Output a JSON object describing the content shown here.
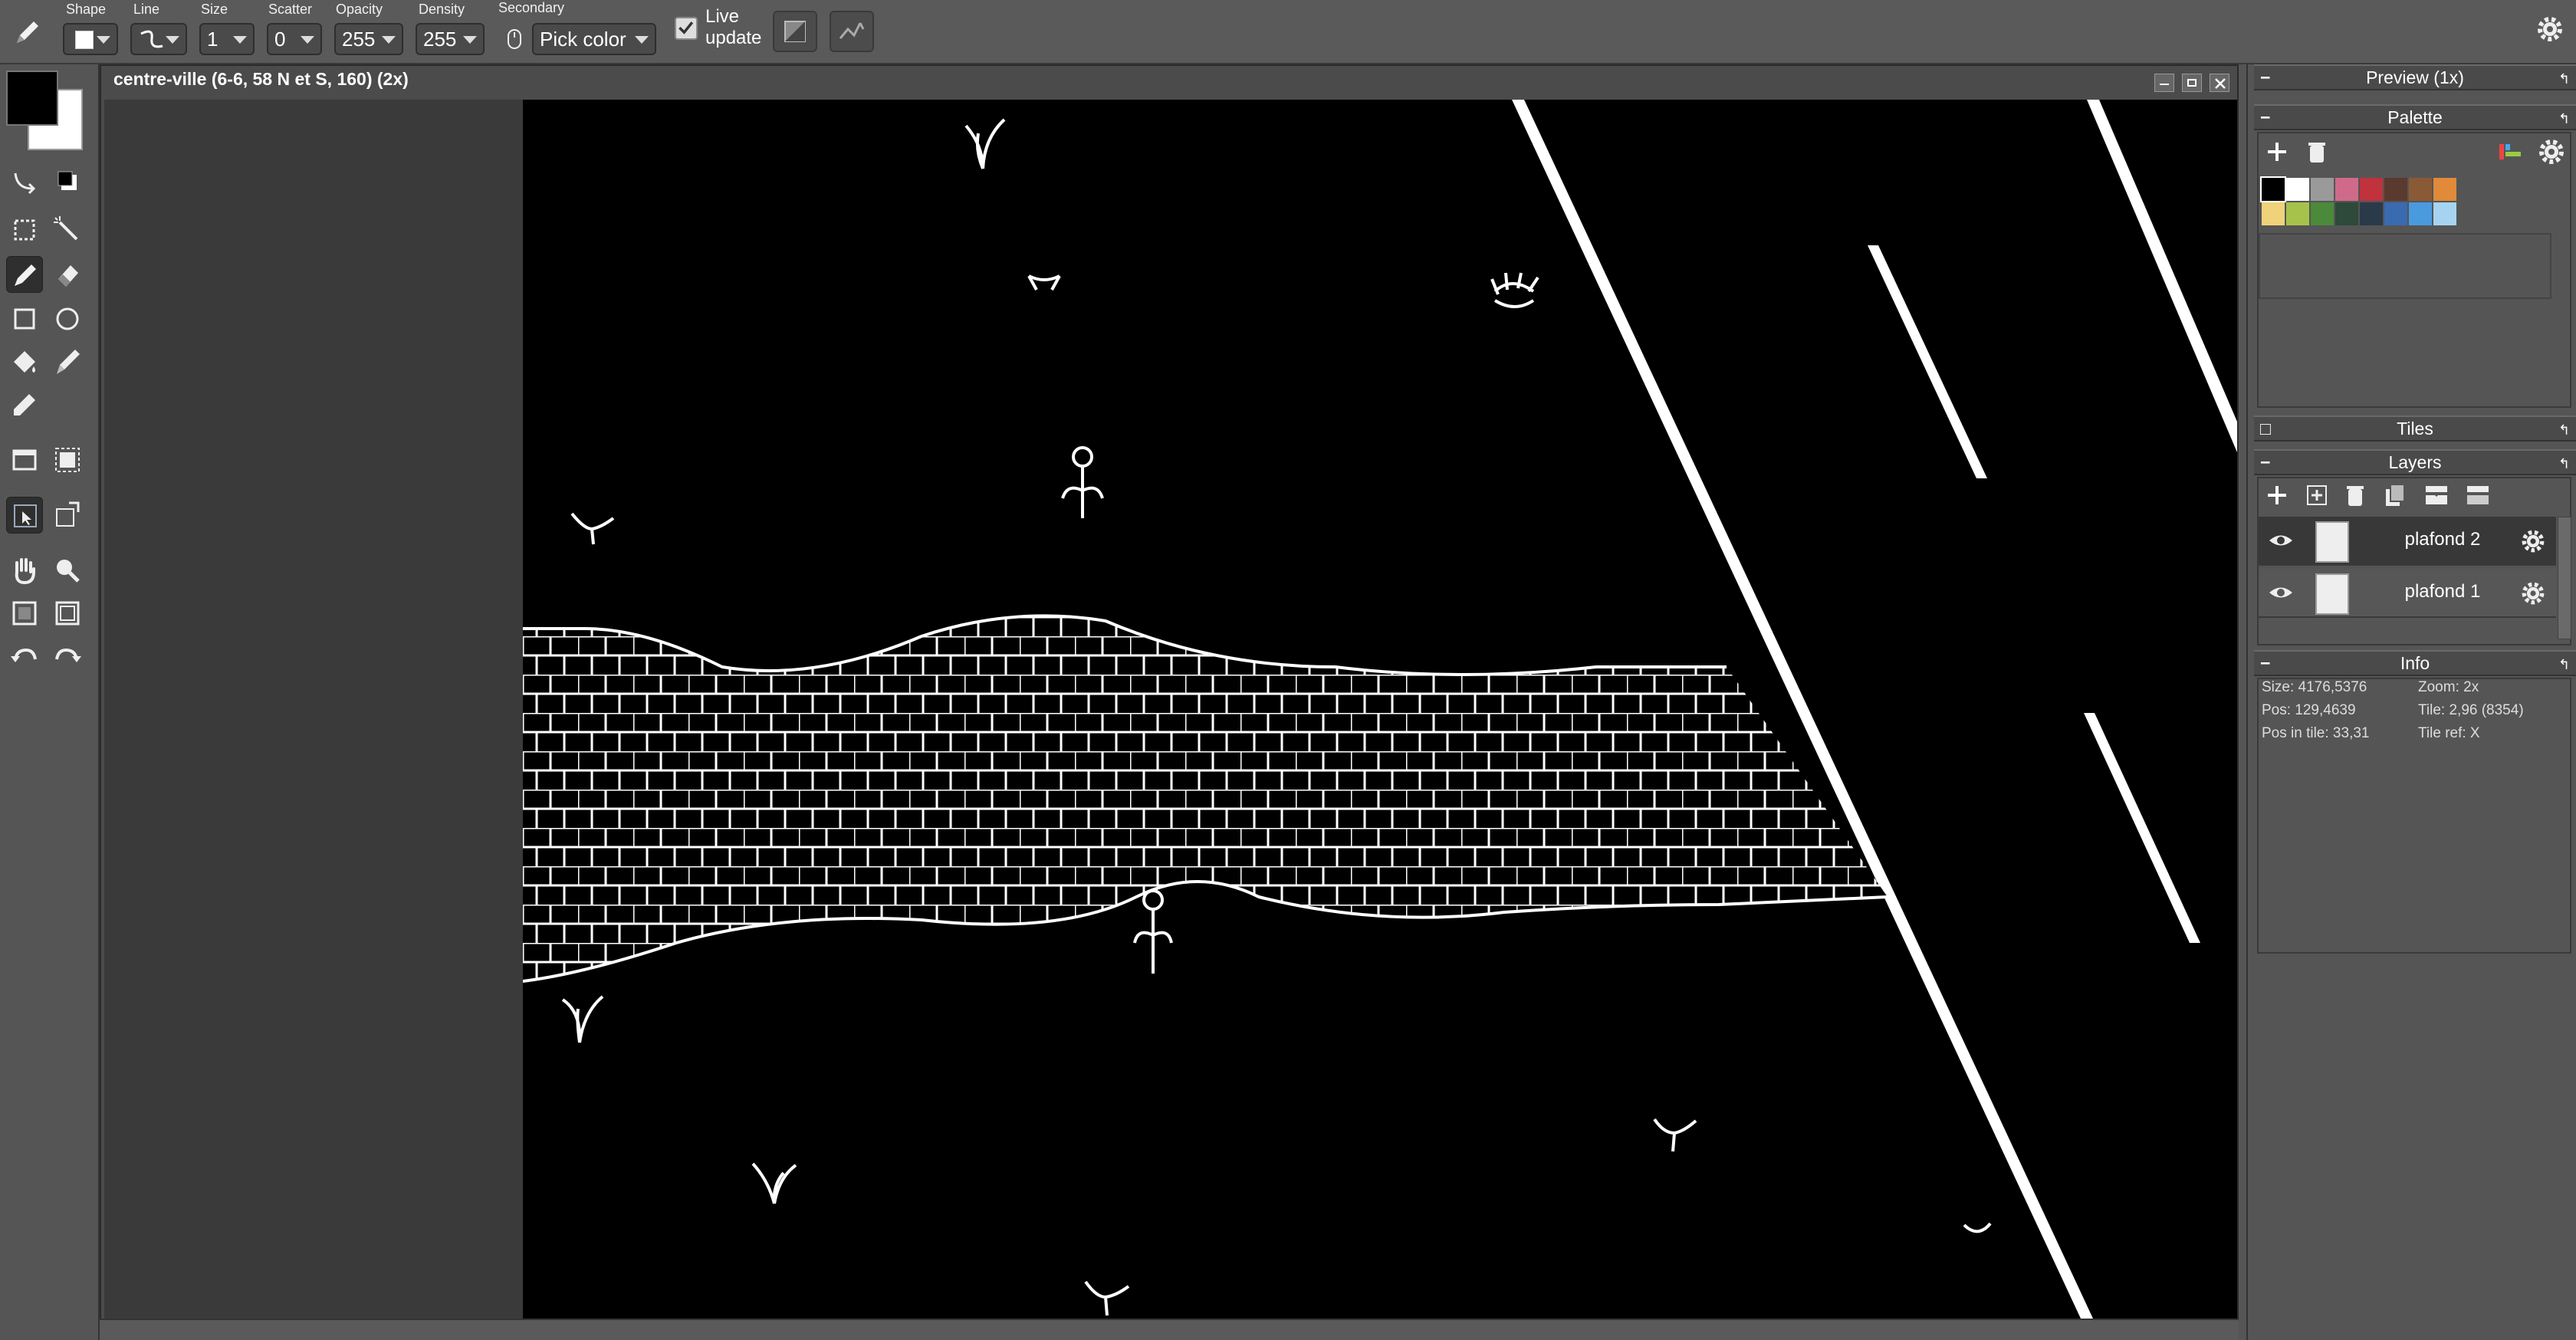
{
  "toolbar": {
    "tool_icon": "pencil-icon",
    "shape_label": "Shape",
    "line_label": "Line",
    "size_label": "Size",
    "size_value": "1",
    "scatter_label": "Scatter",
    "scatter_value": "0",
    "opacity_label": "Opacity",
    "opacity_value": "255",
    "density_label": "Density",
    "density_value": "255",
    "secondary_label": "Secondary",
    "secondary_value": "Pick color",
    "live_update_line1": "Live",
    "live_update_line2": "update",
    "live_update_checked": true
  },
  "colors": {
    "primary": "#000000",
    "secondary": "#ffffff",
    "ui_bg": "#555555",
    "canvas_bg": "#000000"
  },
  "document": {
    "title": "centre-ville (6-6, 58 N et S, 160)   (2x)"
  },
  "panels": {
    "preview": {
      "title": "Preview (1x)"
    },
    "palette": {
      "title": "Palette",
      "colors": [
        "#000000",
        "#ffffff",
        "#9a9a9a",
        "#d06a8a",
        "#c0323c",
        "#5a3a2e",
        "#8a5a36",
        "#e08a3a",
        "#f0d27a",
        "#a6c24a",
        "#4a8a3a",
        "#2e4a3a",
        "#2a3a4a",
        "#3a6ab0",
        "#4a9adf",
        "#a6d4f0"
      ]
    },
    "tiles": {
      "title": "Tiles"
    },
    "layers": {
      "title": "Layers",
      "items": [
        {
          "name": "plafond 2",
          "selected": true
        },
        {
          "name": "plafond 1",
          "selected": false
        }
      ]
    },
    "info": {
      "title": "Info",
      "size": "Size: 4176,5376",
      "zoom": "Zoom: 2x",
      "pos": "Pos: 129,4639",
      "tile": "Tile: 2,96 (8354)",
      "pos_in_tile": "Pos in tile: 33,31",
      "tile_ref": "Tile ref: X"
    }
  }
}
